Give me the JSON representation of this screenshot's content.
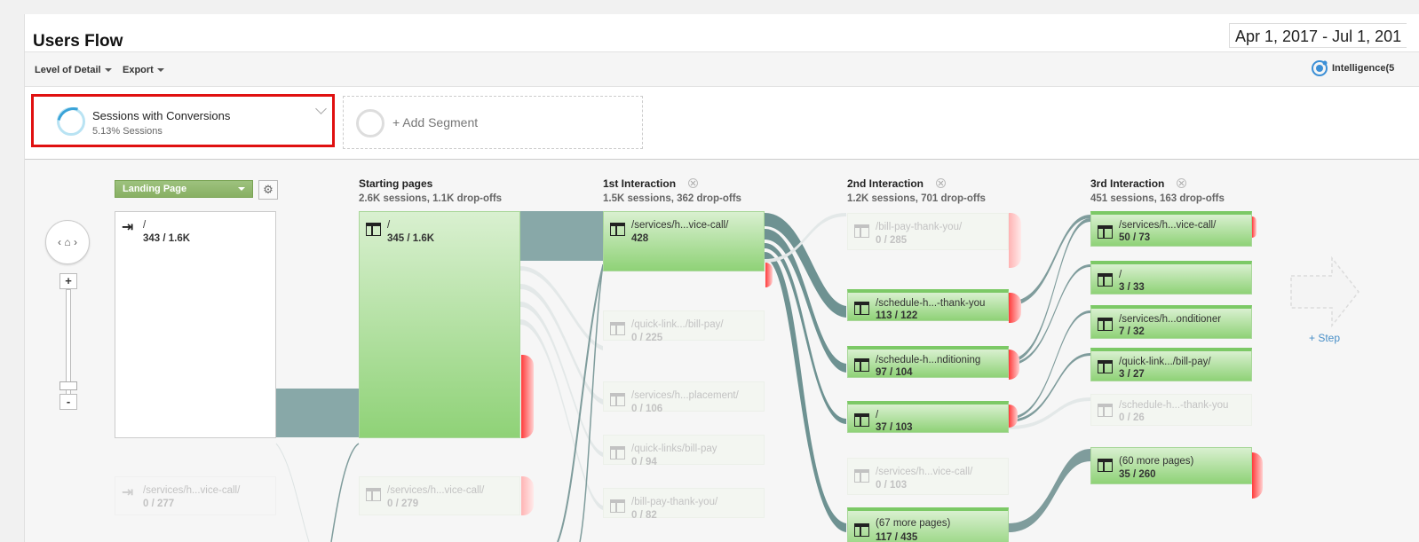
{
  "header": {
    "title": "Users Flow",
    "date_range": "Apr 1, 2017 - Jul 1, 201"
  },
  "toolbar": {
    "level_of_detail": "Level of Detail",
    "export": "Export",
    "intelligence": "Intelligence(5"
  },
  "segments": {
    "active": {
      "name": "Sessions with Conversions",
      "sub": "5.13% Sessions"
    },
    "add": "+ Add Segment"
  },
  "flow": {
    "dimension": "Landing Page",
    "nav_glyphs": {
      "left": "‹",
      "home": "⌂",
      "right": "›"
    },
    "zoom": {
      "plus": "+",
      "minus": "-"
    },
    "columns": [
      {
        "header": "Starting pages",
        "summary": "2.6K sessions, 1.1K drop-offs"
      },
      {
        "header": "1st Interaction",
        "summary": "1.5K sessions, 362 drop-offs"
      },
      {
        "header": "2nd Interaction",
        "summary": "1.2K sessions, 701 drop-offs"
      },
      {
        "header": "3rd Interaction",
        "summary": "451 sessions, 163 drop-offs"
      }
    ],
    "landing": [
      {
        "label": "/",
        "value": "343 / 1.6K"
      },
      {
        "label": "/services/h...vice-call/",
        "value": "0 / 277"
      }
    ],
    "starting": [
      {
        "label": "/",
        "value": "345 / 1.6K"
      },
      {
        "label": "/services/h...vice-call/",
        "value": "0 / 279"
      }
    ],
    "first": [
      {
        "label": "/services/h...vice-call/",
        "value": "428"
      },
      {
        "label": "/quick-link.../bill-pay/",
        "value": "0 / 225"
      },
      {
        "label": "/services/h...placement/",
        "value": "0 / 106"
      },
      {
        "label": "/quick-links/bill-pay",
        "value": "0 / 94"
      },
      {
        "label": "/bill-pay-thank-you/",
        "value": "0 / 82"
      }
    ],
    "second": [
      {
        "label": "/bill-pay-thank-you/",
        "value": "0 / 285"
      },
      {
        "label": "/schedule-h...-thank-you",
        "value": "113 / 122"
      },
      {
        "label": "/schedule-h...nditioning",
        "value": "97 / 104"
      },
      {
        "label": "/",
        "value": "37 / 103"
      },
      {
        "label": "/services/h...vice-call/",
        "value": "0 / 103"
      },
      {
        "label": "(67 more pages)",
        "value": "117 / 435"
      }
    ],
    "third": [
      {
        "label": "/services/h...vice-call/",
        "value": "50 / 73"
      },
      {
        "label": "/",
        "value": "3 / 33"
      },
      {
        "label": "/services/h...onditioner",
        "value": "7 / 32"
      },
      {
        "label": "/quick-link.../bill-pay/",
        "value": "3 / 27"
      },
      {
        "label": "/schedule-h...-thank-you",
        "value": "0 / 26"
      },
      {
        "label": "(60 more pages)",
        "value": "35 / 260"
      }
    ],
    "step": "+ Step"
  }
}
